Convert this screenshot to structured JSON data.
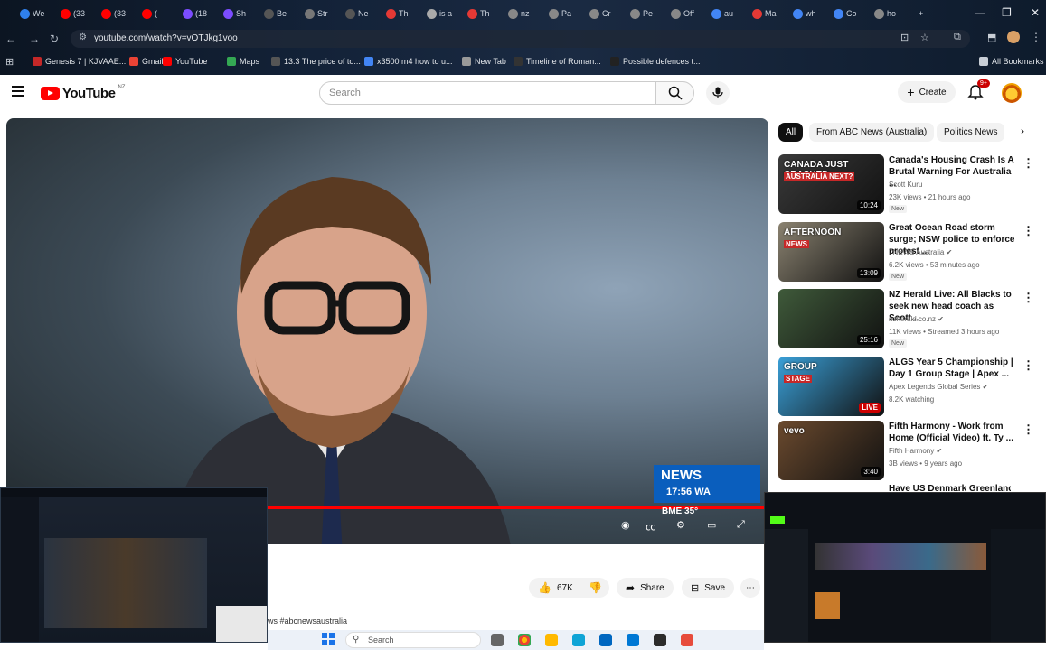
{
  "browser": {
    "tabs": [
      {
        "label": "We",
        "color": "#2f80ed"
      },
      {
        "label": "(33",
        "color": "#ff0000"
      },
      {
        "label": "(33",
        "color": "#ff0000"
      },
      {
        "label": "(",
        "color": "#ff0000"
      },
      {
        "label": "(18",
        "color": "#7c4dff"
      },
      {
        "label": "Sh",
        "color": "#7c4dff"
      },
      {
        "label": "Be",
        "color": "#555555"
      },
      {
        "label": "Str",
        "color": "#777777"
      },
      {
        "label": "Ne",
        "color": "#555555"
      },
      {
        "label": "Th",
        "color": "#e53935"
      },
      {
        "label": "is a",
        "color": "#aaaaaa"
      },
      {
        "label": "Th",
        "color": "#e53935"
      },
      {
        "label": "nz",
        "color": "#888888"
      },
      {
        "label": "Pa",
        "color": "#888888"
      },
      {
        "label": "Cr",
        "color": "#888888"
      },
      {
        "label": "Pe",
        "color": "#888888"
      },
      {
        "label": "Off",
        "color": "#888888"
      },
      {
        "label": "au",
        "color": "#4285f4"
      },
      {
        "label": "Ma",
        "color": "#e53935"
      },
      {
        "label": "wh",
        "color": "#4285f4"
      },
      {
        "label": "Co",
        "color": "#4285f4"
      },
      {
        "label": "ho",
        "color": "#888888"
      }
    ],
    "url": "youtube.com/watch?v=vOTJkg1voo",
    "bookmarks": [
      {
        "label": "Genesis 7 | KJVAAE...",
        "color": "#c62828"
      },
      {
        "label": "Gmail",
        "color": "#ea4335"
      },
      {
        "label": "YouTube",
        "color": "#ff0000"
      },
      {
        "label": "Maps",
        "color": "#34a853"
      },
      {
        "label": "13.3 The price of to...",
        "color": "#555555"
      },
      {
        "label": "x3500 m4 how to u...",
        "color": "#4285f4"
      },
      {
        "label": "New Tab",
        "color": "#999999"
      },
      {
        "label": "Timeline of Roman...",
        "color": "#333333"
      },
      {
        "label": "Possible defences t...",
        "color": "#222222"
      }
    ],
    "all_bookmarks_label": "All Bookmarks"
  },
  "header": {
    "logo_text": "YouTube",
    "country_code": "NZ",
    "search_placeholder": "Search",
    "create_label": "Create",
    "notification_badge": "9+"
  },
  "video": {
    "progress": 1.0,
    "news_brand": "NEWS",
    "news_time": "17:56 WA",
    "weather_city": "BME",
    "weather_temp": "35°"
  },
  "actions": {
    "like_count": "67K",
    "share_label": "Share",
    "save_label": "Save"
  },
  "description": {
    "hashtag": "ws #abcnewsaustralia"
  },
  "chips": [
    {
      "label": "All",
      "active": true
    },
    {
      "label": "From ABC News (Australia)",
      "active": false
    },
    {
      "label": "Politics News",
      "active": false
    }
  ],
  "recommendations": [
    {
      "title": "Canada's Housing Crash Is A Brutal Warning For Australia ...",
      "channel": "Scott Kuru",
      "meta": "23K views • 21 hours ago",
      "badge": "New",
      "duration": "10:24",
      "thumb_text": "CANADA JUST CRASHED",
      "thumb_sub": "AUSTRALIA NEXT?",
      "thumb_color": "#3a3a3a",
      "verified": false,
      "live": false
    },
    {
      "title": "Great Ocean Road storm surge; NSW police to enforce protest ...",
      "channel": "7NEWS Australia",
      "meta": "6.2K views • 53 minutes ago",
      "badge": "New",
      "duration": "13:09",
      "thumb_text": "AFTERNOON",
      "thumb_sub": "NEWS",
      "thumb_color": "#8a8270",
      "verified": true,
      "live": false
    },
    {
      "title": "NZ Herald Live: All Blacks to seek new head coach as Scott...",
      "channel": "nzherald.co.nz",
      "meta": "11K views • Streamed 3 hours ago",
      "badge": "New",
      "duration": "25:16",
      "thumb_text": "",
      "thumb_sub": "",
      "thumb_color": "#3f5a3a",
      "verified": true,
      "live": false
    },
    {
      "title": "ALGS Year 5 Championship | Day 1 Group Stage | Apex ...",
      "channel": "Apex Legends Global Series",
      "meta": "8.2K watching",
      "badge": "",
      "duration": "LIVE",
      "thumb_text": "GROUP",
      "thumb_sub": "STAGE",
      "thumb_color": "#3aa0d8",
      "verified": true,
      "live": true
    },
    {
      "title": "Fifth Harmony - Work from Home (Official Video) ft. Ty ...",
      "channel": "Fifth Harmony",
      "meta": "3B views • 9 years ago",
      "badge": "",
      "duration": "3:40",
      "thumb_text": "vevo",
      "thumb_sub": "",
      "thumb_color": "#6b4a2e",
      "verified": true,
      "live": false
    }
  ],
  "partial_title": "Have US Denmark Greenland",
  "taskbar": {
    "search_label": "Search"
  }
}
